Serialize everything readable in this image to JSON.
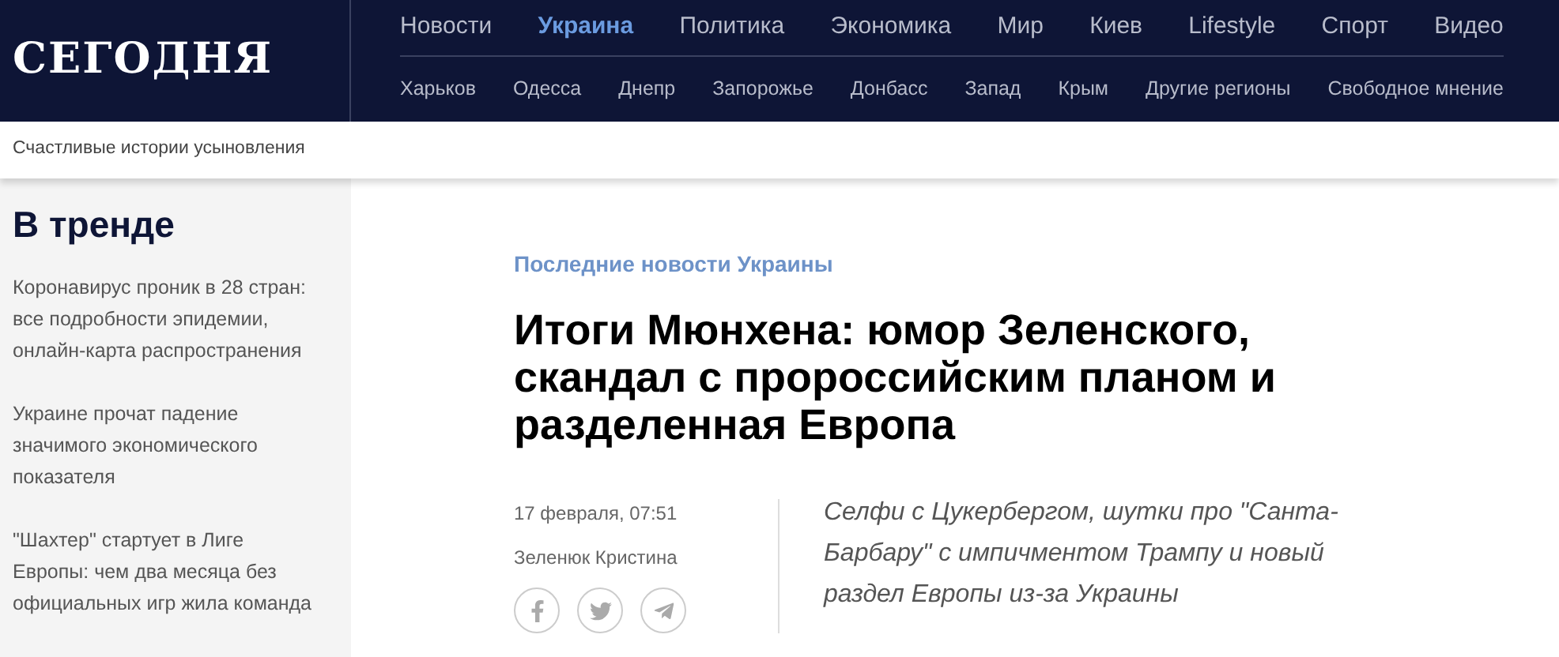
{
  "logo": "СЕГОДНЯ",
  "main_nav": [
    {
      "label": "Новости",
      "selected": false
    },
    {
      "label": "Украина",
      "selected": true
    },
    {
      "label": "Политика",
      "selected": false
    },
    {
      "label": "Экономика",
      "selected": false
    },
    {
      "label": "Мир",
      "selected": false
    },
    {
      "label": "Киев",
      "selected": false
    },
    {
      "label": "Lifestyle",
      "selected": false
    },
    {
      "label": "Спорт",
      "selected": false
    },
    {
      "label": "Видео",
      "selected": false
    }
  ],
  "sub_nav": [
    "Харьков",
    "Одесса",
    "Днепр",
    "Запорожье",
    "Донбасс",
    "Запад",
    "Крым",
    "Другие регионы",
    "Свободное мнение"
  ],
  "promo_bar": "Счастливые истории усыновления",
  "sidebar": {
    "title": "В тренде",
    "items": [
      "Коронавирус проник в 28 стран: все подробности эпидемии, онлайн-карта распространения",
      "Украине прочат падение значимого экономического показателя",
      "\"Шахтер\" стартует в Лиге Европы: чем два месяца без официальных игр жила команда"
    ]
  },
  "article": {
    "category": "Последние новости Украины",
    "title": "Итоги Мюнхена: юмор Зеленского, скандал с пророссийским планом и разделенная Европа",
    "date": "17 февраля, 07:51",
    "author": "Зеленюк Кристина",
    "share": [
      {
        "kind": "facebook"
      },
      {
        "kind": "twitter"
      },
      {
        "kind": "telegram"
      }
    ],
    "lead": "Селфи с Цукербергом, шутки про \"Санта-Барбару\" с импичментом Трампу и новый раздел Европы из-за Украины"
  }
}
